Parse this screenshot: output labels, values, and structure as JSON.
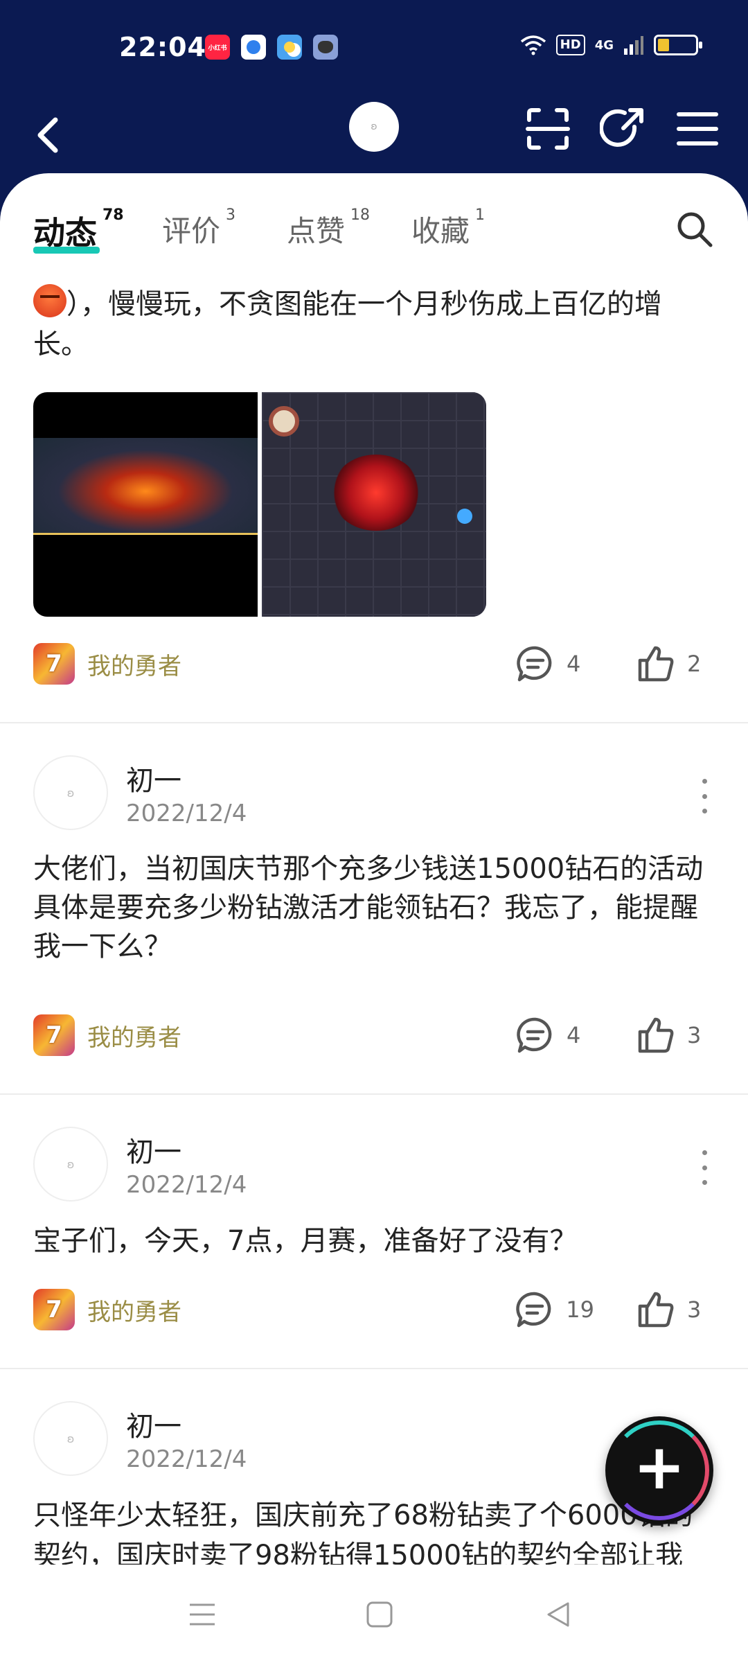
{
  "status_bar": {
    "time": "22:04",
    "app_icons": [
      "xiaohongshu-icon",
      "blue-app-icon",
      "weather-icon",
      "cat-app-icon"
    ],
    "xiaohongshu_label": "小红书",
    "network": "HD",
    "signal": "4G",
    "battery_level": 0.25
  },
  "header": {
    "back_icon": "back-icon",
    "scan_icon": "scan-icon",
    "share_icon": "share-icon",
    "menu_icon": "menu-icon"
  },
  "tabs": [
    {
      "label": "动态",
      "count": "78",
      "active": true
    },
    {
      "label": "评价",
      "count": "3",
      "active": false
    },
    {
      "label": "点赞",
      "count": "18",
      "active": false
    },
    {
      "label": "收藏",
      "count": "1",
      "active": false
    }
  ],
  "posts": [
    {
      "text": "），慢慢玩，不贪图能在一个月秒伤成上百亿的增长。",
      "has_images": true,
      "game": "我的勇者",
      "comments": "4",
      "likes": "2"
    },
    {
      "author": "初一",
      "date": "2022/12/4",
      "text": "大佬们，当初国庆节那个充多少钱送15000钻石的活动具体是要充多少粉钻激活才能领钻石？我忘了，能提醒我一下么？",
      "game": "我的勇者",
      "comments": "4",
      "likes": "3"
    },
    {
      "author": "初一",
      "date": "2022/12/4",
      "text": "宝子们，今天，7点，月赛，准备好了没有？",
      "game": "我的勇者",
      "comments": "19",
      "likes": "3"
    },
    {
      "author": "初一",
      "date": "2022/12/4",
      "text": "只怪年少太轻狂，国庆前充了68粉钻卖了个6000钻的契约，国庆时卖了98粉钻得15000钻的契约全部让我"
    }
  ],
  "fab": {
    "icon": "plus-icon"
  },
  "colors": {
    "header_bg": "#0b1a52",
    "accent": "#18c8b5",
    "game_name": "#9a8d45"
  }
}
